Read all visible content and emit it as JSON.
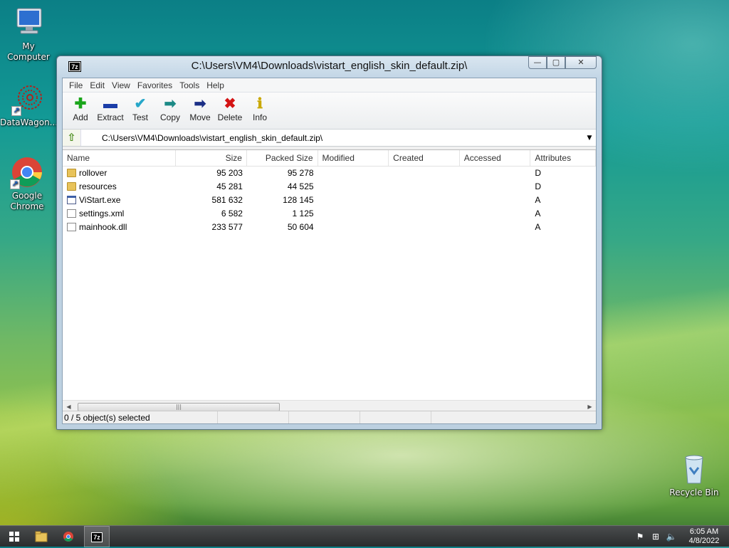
{
  "desktop": {
    "icons": [
      {
        "label": "My Computer"
      },
      {
        "label": "DataWagon..."
      },
      {
        "label": "Google Chrome"
      },
      {
        "label": "Recycle Bin"
      }
    ]
  },
  "window": {
    "app_icon": "7z",
    "title": "C:\\Users\\VM4\\Downloads\\vistart_english_skin_default.zip\\",
    "menu": [
      "File",
      "Edit",
      "View",
      "Favorites",
      "Tools",
      "Help"
    ],
    "toolbar": [
      {
        "label": "Add",
        "icon": "plus-icon",
        "color": "#1aa51a"
      },
      {
        "label": "Extract",
        "icon": "minus-icon",
        "color": "#1b3ea8"
      },
      {
        "label": "Test",
        "icon": "check-icon",
        "color": "#27a7c9"
      },
      {
        "label": "Copy",
        "icon": "arrow-right-double-icon",
        "color": "#1c8a86"
      },
      {
        "label": "Move",
        "icon": "arrow-right-icon",
        "color": "#1b2f86"
      },
      {
        "label": "Delete",
        "icon": "x-icon",
        "color": "#d41414"
      },
      {
        "label": "Info",
        "icon": "info-icon",
        "color": "#c9a800"
      }
    ],
    "address": "C:\\Users\\VM4\\Downloads\\vistart_english_skin_default.zip\\",
    "columns": [
      "Name",
      "Size",
      "Packed Size",
      "Modified",
      "Created",
      "Accessed",
      "Attributes"
    ],
    "files": [
      {
        "name": "rollover",
        "type": "folder",
        "size": "95 203",
        "packed": "95 278",
        "attr": "D"
      },
      {
        "name": "resources",
        "type": "folder",
        "size": "45 281",
        "packed": "44 525",
        "attr": "D"
      },
      {
        "name": "ViStart.exe",
        "type": "exe",
        "size": "581 632",
        "packed": "128 145",
        "attr": "A"
      },
      {
        "name": "settings.xml",
        "type": "doc",
        "size": "6 582",
        "packed": "1 125",
        "attr": "A"
      },
      {
        "name": "mainhook.dll",
        "type": "dll",
        "size": "233 577",
        "packed": "50 604",
        "attr": "A"
      }
    ],
    "status": "0 / 5 object(s) selected"
  },
  "taskbar": {
    "time": "6:05 AM",
    "date": "4/8/2022",
    "active_app": "7z"
  }
}
